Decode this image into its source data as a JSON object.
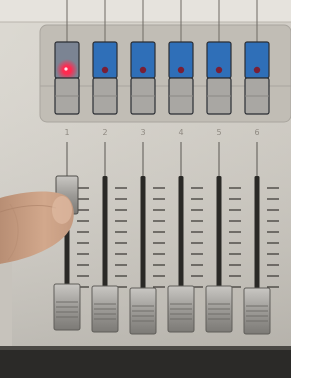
{
  "console": {
    "channels": [
      {
        "number": "1",
        "select_led": "on"
      },
      {
        "number": "2",
        "select_led": "off"
      },
      {
        "number": "3",
        "select_led": "off"
      },
      {
        "number": "4",
        "select_led": "off"
      },
      {
        "number": "5",
        "select_led": "off"
      },
      {
        "number": "6",
        "select_led": "off"
      }
    ],
    "colors": {
      "panel": "#d9d6cf",
      "button_blue": "#2f6fb8",
      "led_red": "#ff2a50",
      "led_dark": "#7a1f35",
      "fader_cap": "#a9a7a3"
    }
  }
}
